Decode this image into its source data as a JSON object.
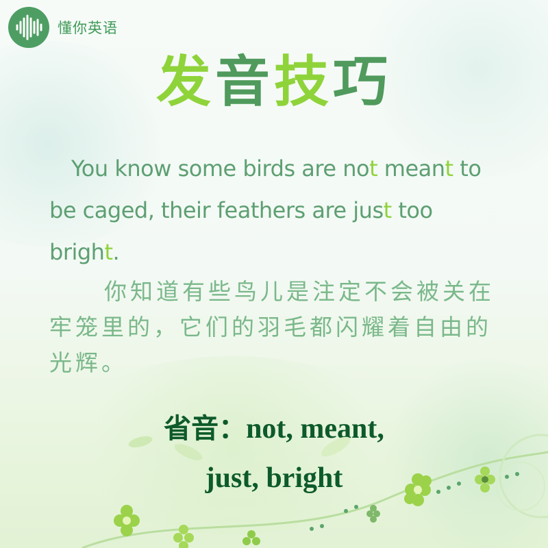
{
  "brand": {
    "name": "懂你英语",
    "logo_icon": "sound-wave-icon",
    "logo_color": "#4e9e63"
  },
  "title": {
    "chars": [
      "发",
      "音",
      "技",
      "巧"
    ],
    "color_light": "#8fd33a",
    "color_dark": "#4f9a5c"
  },
  "english": {
    "segments": [
      "You know some birds are no",
      "t",
      " mean",
      "t",
      " to be caged, their feathers are jus",
      "t",
      " too brigh",
      "t",
      "."
    ],
    "text_color": "#5d9f72",
    "highlight_color": "#8fd33a"
  },
  "chinese": {
    "text": "你知道有些鸟儿是注定不会被关在牢笼里的，它们的羽毛都闪耀着自由的光辉。"
  },
  "elision": {
    "label": "省音：",
    "line1": "not, meant,",
    "line2": "just, bright",
    "color": "#0d5a2a"
  },
  "decoration": {
    "flower_color": "#9bd24a",
    "dot_color": "#5aa56c"
  }
}
